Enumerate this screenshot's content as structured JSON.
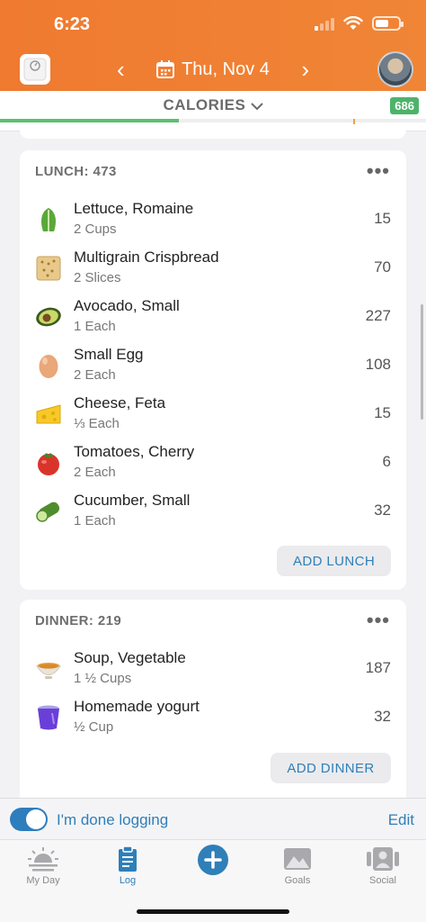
{
  "status_bar": {
    "time": "6:23"
  },
  "header": {
    "date": "Thu, Nov 4",
    "prev_glyph": "‹",
    "next_glyph": "›",
    "colors": {
      "header_orange": "#ef7a30"
    }
  },
  "calories_bar": {
    "label": "CALORIES",
    "remaining_badge": "686",
    "progress_fraction": 0.42,
    "colors": {
      "progress": "#5bbf72",
      "badge": "#4db36a"
    }
  },
  "lunch": {
    "title": "LUNCH: 473",
    "more": "•••",
    "items": [
      {
        "name": "Lettuce, Romaine",
        "qty": "2 Cups",
        "cal": "15",
        "icon": "lettuce-icon"
      },
      {
        "name": "Multigrain Crispbread",
        "qty": "2 Slices",
        "cal": "70",
        "icon": "crispbread-icon"
      },
      {
        "name": "Avocado, Small",
        "qty": "1 Each",
        "cal": "227",
        "icon": "avocado-icon"
      },
      {
        "name": "Small Egg",
        "qty": "2 Each",
        "cal": "108",
        "icon": "egg-icon"
      },
      {
        "name": "Cheese, Feta",
        "qty": "⅓ Each",
        "cal": "15",
        "icon": "cheese-icon"
      },
      {
        "name": "Tomatoes, Cherry",
        "qty": "2 Each",
        "cal": "6",
        "icon": "tomato-icon"
      },
      {
        "name": "Cucumber, Small",
        "qty": "1 Each",
        "cal": "32",
        "icon": "cucumber-icon"
      }
    ],
    "add_label": "ADD LUNCH"
  },
  "dinner": {
    "title": "DINNER: 219",
    "more": "•••",
    "items": [
      {
        "name": "Soup, Vegetable",
        "qty": "1 ½ Cups",
        "cal": "187",
        "icon": "soup-bowl-icon"
      },
      {
        "name": "Homemade yogurt",
        "qty": "½ Cup",
        "cal": "32",
        "icon": "yogurt-cup-icon"
      }
    ],
    "add_label": "ADD DINNER"
  },
  "done_logging": {
    "label": "I'm done logging",
    "edit": "Edit",
    "toggle_on": true
  },
  "tabs": [
    {
      "label": "My Day",
      "icon": "sunrise-icon"
    },
    {
      "label": "Log",
      "icon": "clipboard-icon",
      "active": true
    },
    {
      "label": "Goals",
      "icon": "mountain-icon"
    },
    {
      "label": "Social",
      "icon": "people-icon"
    }
  ],
  "accent_color": "#2f7fb8"
}
